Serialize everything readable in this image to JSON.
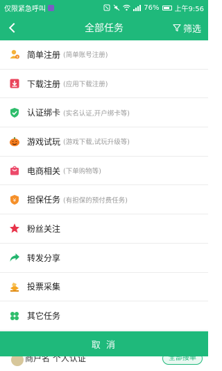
{
  "status_bar": {
    "carrier": "仅限紧急呼叫",
    "battery": "76%",
    "time": "上午9:56"
  },
  "nav": {
    "title": "全部任务",
    "filter_label": "筛选",
    "back_icon": "chevron-left-icon",
    "filter_icon": "funnel-icon"
  },
  "categories": [
    {
      "name": "简单注册",
      "desc": "(简单账号注册)",
      "icon": "user-coin-icon"
    },
    {
      "name": "下载注册",
      "desc": "(应用下载注册)",
      "icon": "download-box-icon"
    },
    {
      "name": "认证绑卡",
      "desc": "(实名认证,开户绑卡等)",
      "icon": "shield-check-icon"
    },
    {
      "name": "游戏试玩",
      "desc": "(游戏下载,试玩升级等)",
      "icon": "pumpkin-icon"
    },
    {
      "name": "电商相关",
      "desc": "(下单购物等)",
      "icon": "shopping-bag-icon"
    },
    {
      "name": "担保任务",
      "desc": "(有担保的预付费任务)",
      "icon": "guarantee-badge-icon"
    },
    {
      "name": "粉丝关注",
      "desc": "",
      "icon": "star-icon"
    },
    {
      "name": "转发分享",
      "desc": "",
      "icon": "share-arrow-icon"
    },
    {
      "name": "投票采集",
      "desc": "",
      "icon": "vote-box-icon"
    },
    {
      "name": "其它任务",
      "desc": "",
      "icon": "clover-icon"
    }
  ],
  "cancel_label": "取 消",
  "background_peek": {
    "text": "商户名 个人认证",
    "button": "全部接单"
  },
  "colors": {
    "brand": "#1fb97b",
    "divider": "#ececec",
    "desc_gray": "#9a9a9a"
  }
}
